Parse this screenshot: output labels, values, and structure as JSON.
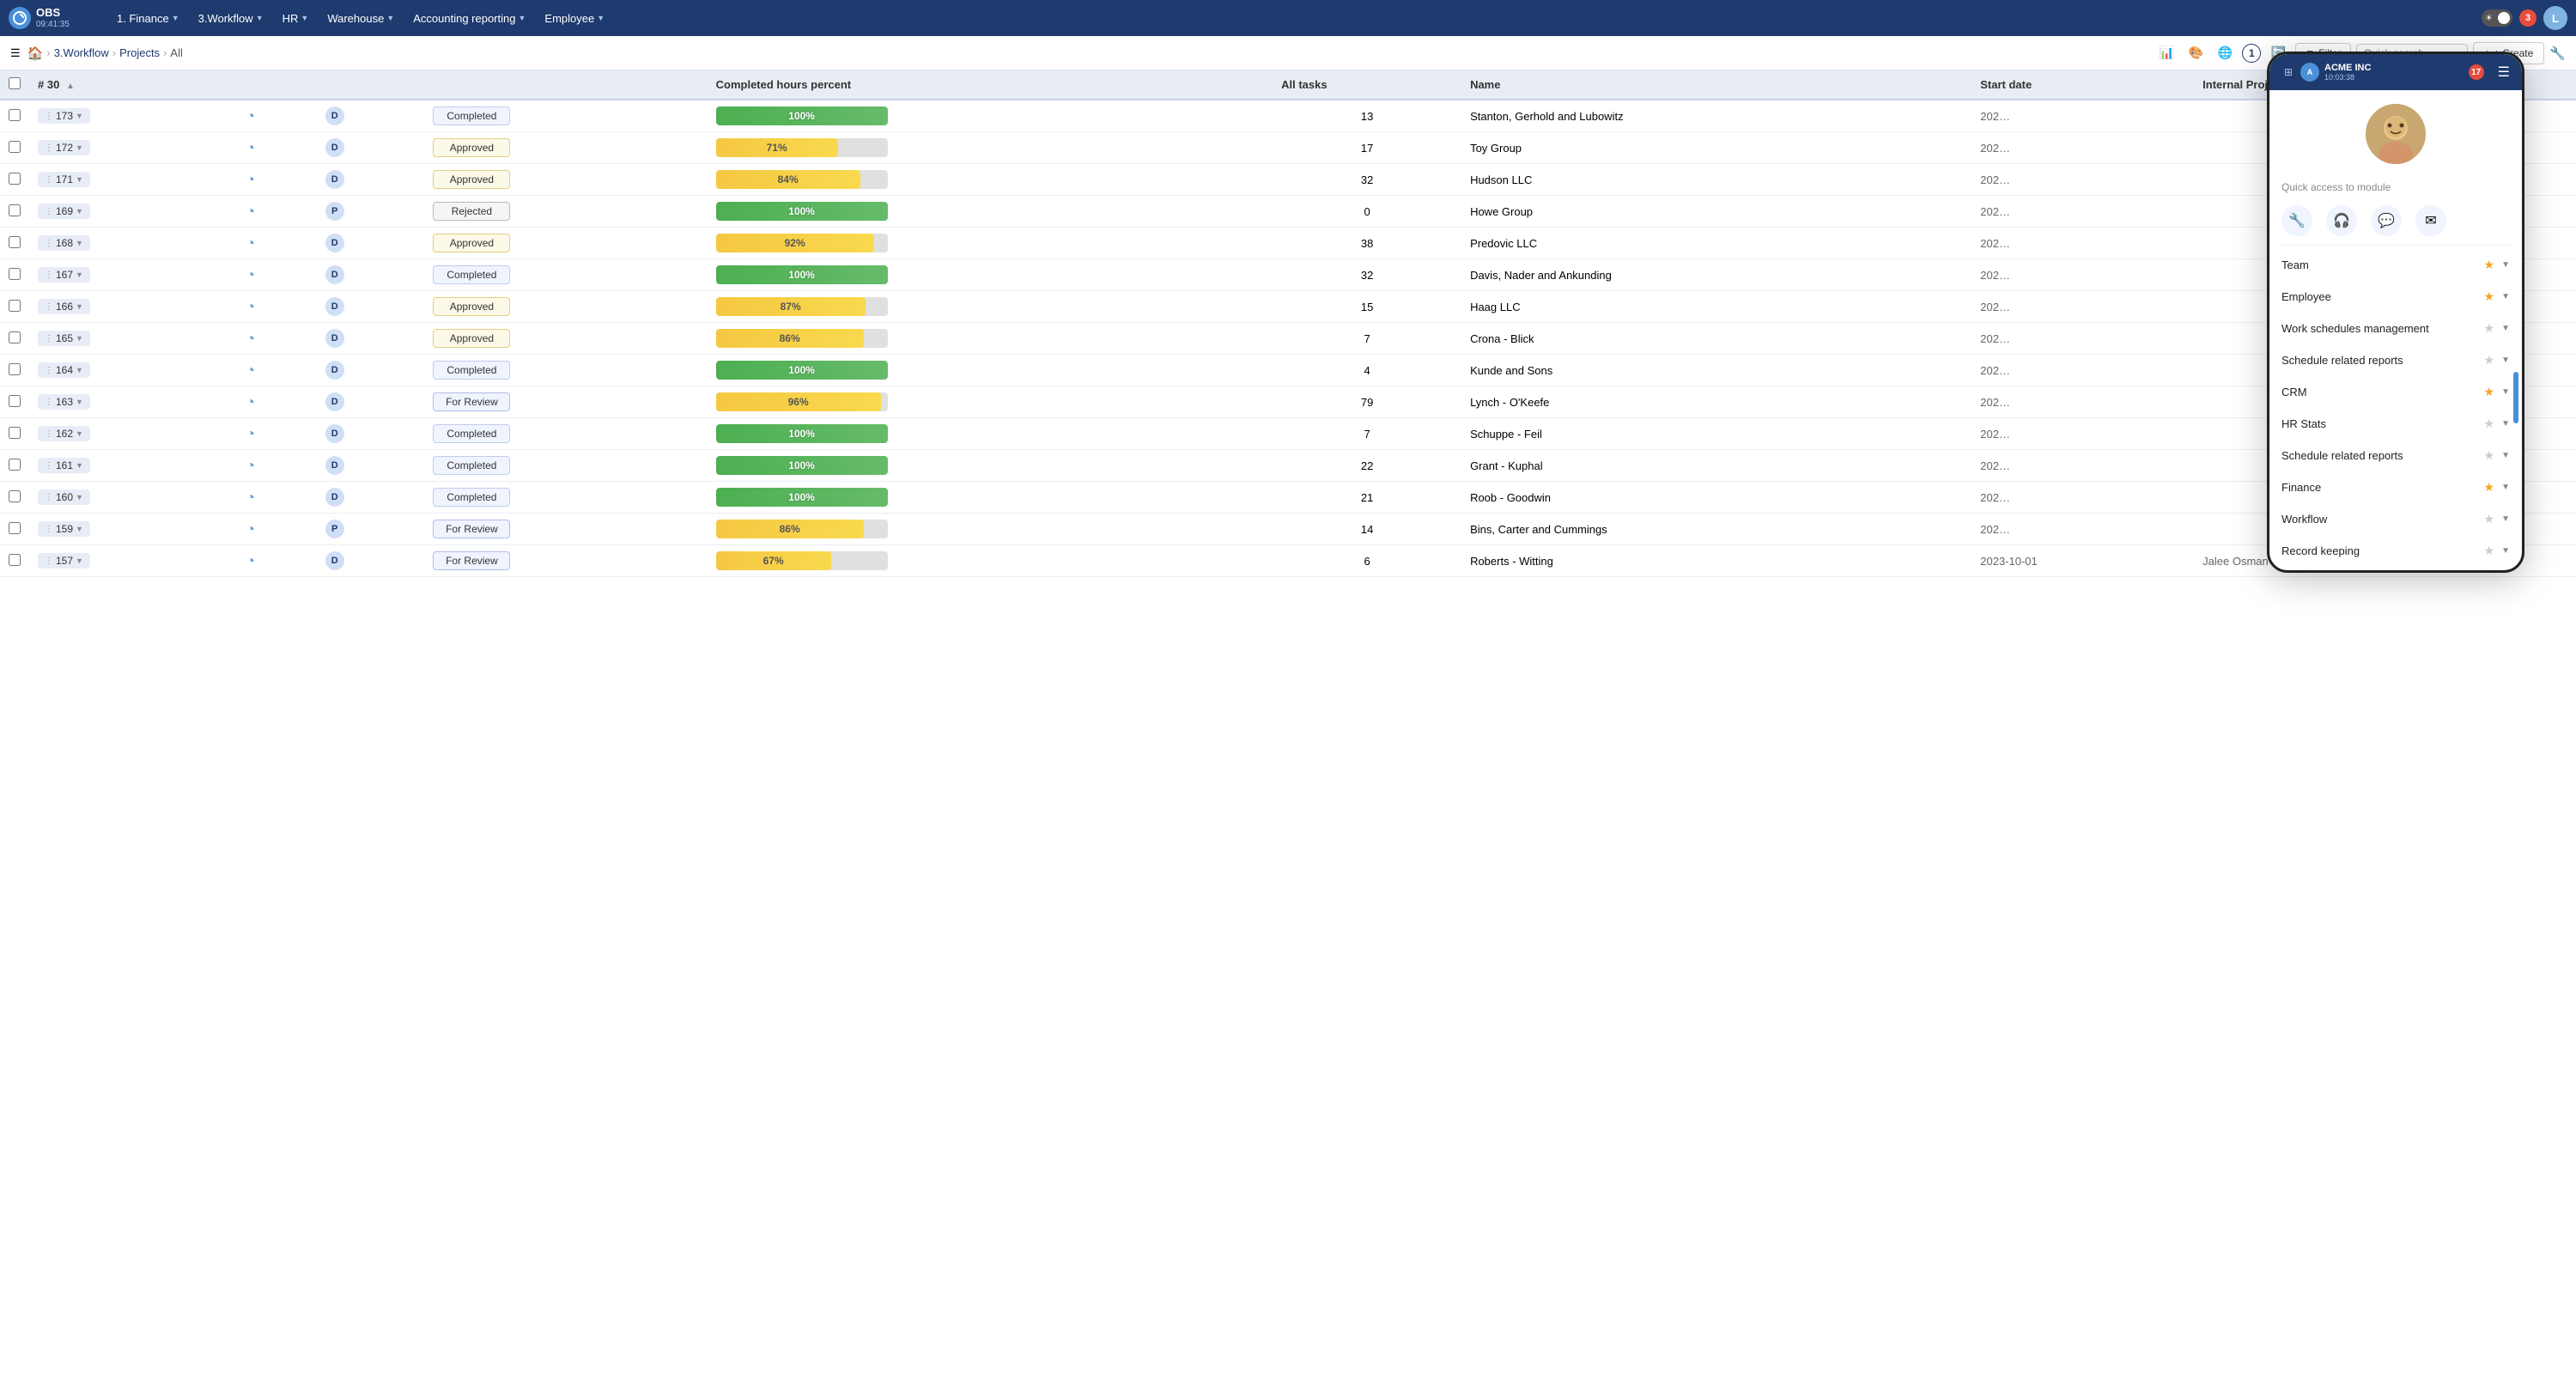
{
  "app": {
    "name": "OBS",
    "time": "09:41:35",
    "logo_letter": "O"
  },
  "top_nav": {
    "items": [
      {
        "label": "1. Finance",
        "has_caret": true
      },
      {
        "label": "3.Workflow",
        "has_caret": true
      },
      {
        "label": "HR",
        "has_caret": true
      },
      {
        "label": "Warehouse",
        "has_caret": true
      },
      {
        "label": "Accounting reporting",
        "has_caret": true
      },
      {
        "label": "Employee",
        "has_caret": true
      }
    ],
    "notification_count": "3",
    "avatar_letter": "L"
  },
  "toolbar": {
    "breadcrumbs": [
      {
        "label": "🏠",
        "is_home": true
      },
      {
        "label": "3.Workflow"
      },
      {
        "label": "Projects"
      },
      {
        "label": "All"
      }
    ],
    "icons": [
      "📊",
      "🎨",
      "🌐",
      "1",
      "🔄"
    ],
    "filter_label": "Filter",
    "search_placeholder": "Quick search",
    "create_label": "+ Create",
    "settings_icon": "⚙"
  },
  "table": {
    "header": {
      "row_num_label": "# 30",
      "completed_hours_label": "Completed hours percent",
      "all_tasks_label": "All tasks",
      "name_label": "Name",
      "start_date_label": "Start date",
      "lead_label": "Internal Project Lead"
    },
    "rows": [
      {
        "id": "173",
        "type": "D",
        "status": "Completed",
        "status_class": "status-completed",
        "progress": 100,
        "fill_class": "fill-green",
        "tasks": 13,
        "name": "Stanton, Gerhold and Lubowitz",
        "start_date": "202…",
        "lead": ""
      },
      {
        "id": "172",
        "type": "D",
        "status": "Approved",
        "status_class": "status-approved",
        "progress": 71,
        "fill_class": "fill-yellow",
        "tasks": 17,
        "name": "Toy Group",
        "start_date": "202…",
        "lead": ""
      },
      {
        "id": "171",
        "type": "D",
        "status": "Approved",
        "status_class": "status-approved",
        "progress": 84,
        "fill_class": "fill-yellow",
        "tasks": 32,
        "name": "Hudson LLC",
        "start_date": "202…",
        "lead": ""
      },
      {
        "id": "169",
        "type": "P",
        "status": "Rejected",
        "status_class": "status-rejected",
        "progress": 100,
        "fill_class": "fill-green",
        "tasks": 0,
        "name": "Howe Group",
        "start_date": "202…",
        "lead": ""
      },
      {
        "id": "168",
        "type": "D",
        "status": "Approved",
        "status_class": "status-approved",
        "progress": 92,
        "fill_class": "fill-yellow",
        "tasks": 38,
        "name": "Predovic LLC",
        "start_date": "202…",
        "lead": ""
      },
      {
        "id": "167",
        "type": "D",
        "status": "Completed",
        "status_class": "status-completed",
        "progress": 100,
        "fill_class": "fill-green",
        "tasks": 32,
        "name": "Davis, Nader and Ankunding",
        "start_date": "202…",
        "lead": ""
      },
      {
        "id": "166",
        "type": "D",
        "status": "Approved",
        "status_class": "status-approved",
        "progress": 87,
        "fill_class": "fill-yellow",
        "tasks": 15,
        "name": "Haag LLC",
        "start_date": "202…",
        "lead": ""
      },
      {
        "id": "165",
        "type": "D",
        "status": "Approved",
        "status_class": "status-approved",
        "progress": 86,
        "fill_class": "fill-yellow",
        "tasks": 7,
        "name": "Crona - Blick",
        "start_date": "202…",
        "lead": ""
      },
      {
        "id": "164",
        "type": "D",
        "status": "Completed",
        "status_class": "status-completed",
        "progress": 100,
        "fill_class": "fill-green",
        "tasks": 4,
        "name": "Kunde and Sons",
        "start_date": "202…",
        "lead": ""
      },
      {
        "id": "163",
        "type": "D",
        "status": "For Review",
        "status_class": "status-for-review",
        "progress": 96,
        "fill_class": "fill-yellow",
        "tasks": 79,
        "name": "Lynch - O'Keefe",
        "start_date": "202…",
        "lead": ""
      },
      {
        "id": "162",
        "type": "D",
        "status": "Completed",
        "status_class": "status-completed",
        "progress": 100,
        "fill_class": "fill-green",
        "tasks": 7,
        "name": "Schuppe - Feil",
        "start_date": "202…",
        "lead": ""
      },
      {
        "id": "161",
        "type": "D",
        "status": "Completed",
        "status_class": "status-completed",
        "progress": 100,
        "fill_class": "fill-green",
        "tasks": 22,
        "name": "Grant - Kuphal",
        "start_date": "202…",
        "lead": ""
      },
      {
        "id": "160",
        "type": "D",
        "status": "Completed",
        "status_class": "status-completed",
        "progress": 100,
        "fill_class": "fill-green",
        "tasks": 21,
        "name": "Roob - Goodwin",
        "start_date": "202…",
        "lead": ""
      },
      {
        "id": "159",
        "type": "P",
        "status": "For Review",
        "status_class": "status-for-review",
        "progress": 86,
        "fill_class": "fill-yellow",
        "tasks": 14,
        "name": "Bins, Carter and Cummings",
        "start_date": "202…",
        "lead": ""
      },
      {
        "id": "157",
        "type": "D",
        "status": "For Review",
        "status_class": "status-for-review",
        "progress": 67,
        "fill_class": "fill-yellow",
        "tasks": 6,
        "name": "Roberts - Witting",
        "start_date": "2023-10-01",
        "lead": "Jalee Osman"
      }
    ]
  },
  "mobile_panel": {
    "company": "ACME INC",
    "time": "10:03:38",
    "notification_count": "17",
    "quick_access_label": "Quick access to module",
    "icons": [
      "🔧",
      "🎧",
      "💬",
      "✉"
    ],
    "menu_items": [
      {
        "label": "Team",
        "starred": true
      },
      {
        "label": "Employee",
        "starred": true
      },
      {
        "label": "Work schedules management",
        "starred": false
      },
      {
        "label": "Schedule related reports",
        "starred": false
      },
      {
        "label": "CRM",
        "starred": true
      },
      {
        "label": "HR Stats",
        "starred": false
      },
      {
        "label": "Schedule related reports",
        "starred": false
      },
      {
        "label": "Finance",
        "starred": true
      },
      {
        "label": "Workflow",
        "starred": false
      },
      {
        "label": "Record keeping",
        "starred": false
      }
    ]
  }
}
